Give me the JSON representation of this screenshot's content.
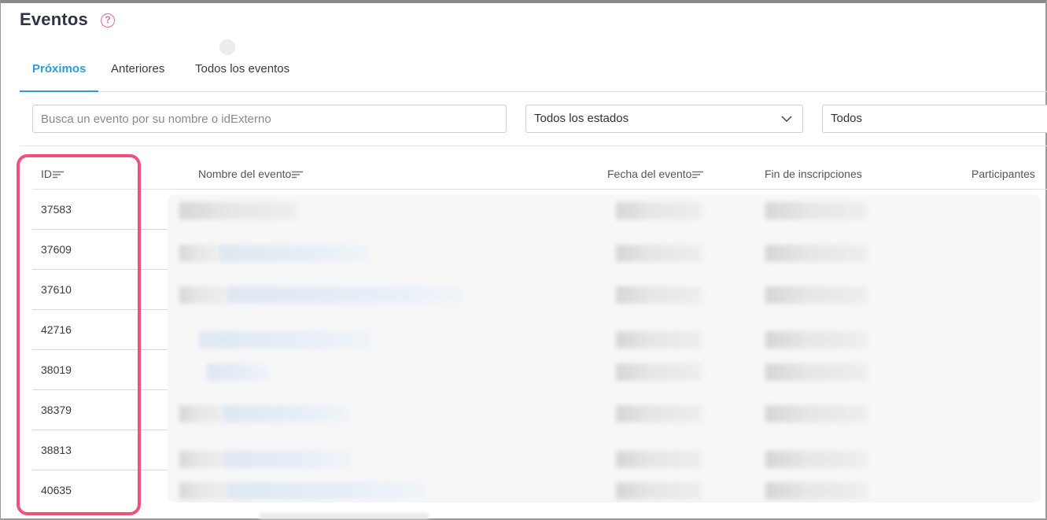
{
  "page": {
    "title": "Eventos",
    "help_icon": "help-circle-icon"
  },
  "tabs": [
    {
      "label": "Próximos",
      "active": true
    },
    {
      "label": "Anteriores",
      "active": false
    },
    {
      "label": "Todos los eventos",
      "active": false
    }
  ],
  "filters": {
    "search_placeholder": "Busca un evento por su nombre o idExterno",
    "search_value": "",
    "status_select": "Todos los estados",
    "type_select": "Todos"
  },
  "table": {
    "columns": [
      "ID",
      "Nombre del evento",
      "Fecha del evento",
      "Fin de inscripciones",
      "Participantes"
    ],
    "sortable": [
      true,
      true,
      true,
      false,
      false
    ],
    "ids": [
      "37583",
      "37609",
      "37610",
      "42716",
      "38019",
      "38379",
      "38813",
      "40635"
    ]
  },
  "colors": {
    "accent": "#2a9ed8",
    "highlight": "#f0507a",
    "help": "#e06aa8"
  }
}
